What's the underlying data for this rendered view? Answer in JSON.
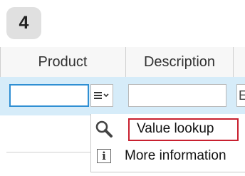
{
  "step": {
    "number": "4"
  },
  "table": {
    "columns": [
      "Product",
      "Description"
    ],
    "row_inputs": {
      "product_value": "",
      "description_value": "",
      "next_value_partial": "E"
    }
  },
  "menu": {
    "items": [
      {
        "label": "Value lookup",
        "icon": "magnifier-icon",
        "highlighted": true
      },
      {
        "label": "More information",
        "icon": "info-icon",
        "highlighted": false
      }
    ]
  },
  "colors": {
    "selected_row": "#d6ecf9",
    "input_focus": "#2f8fd3",
    "highlight_border": "#c8202f",
    "badge_bg": "#e0e0e0"
  }
}
